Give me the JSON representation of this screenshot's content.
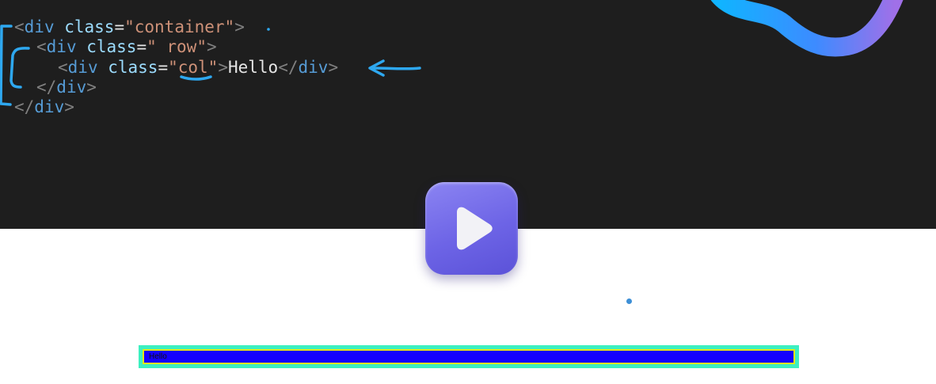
{
  "code": {
    "line1": {
      "open": "<",
      "tag": "div",
      "attr": " class",
      "eq": "=",
      "value": "\"container\"",
      "close": ">"
    },
    "line2": {
      "open": "<",
      "tag": "div",
      "attr": " class",
      "eq": "=",
      "value": "\" row\"",
      "close": ">"
    },
    "line3": {
      "open": "<",
      "tag": "div",
      "attr": " class",
      "eq": "=",
      "value": "\"col\"",
      "close": ">",
      "text": "Hello",
      "end_open": "</",
      "end_tag": "div",
      "end_close": ">"
    },
    "line4": {
      "open": "</",
      "tag": "div",
      "close": ">"
    },
    "line5": {
      "open": "</",
      "tag": "div",
      "close": ">"
    }
  },
  "preview": {
    "text": "Hello"
  },
  "colors": {
    "editor_bg": "#1e1e1e",
    "annotation": "#2ea8f0",
    "play_button": "#7068e8",
    "preview_fill": "#1400ff",
    "preview_border_outer": "#3df0c0",
    "preview_border_inner": "#e5e516"
  },
  "icons": {
    "play": "play-icon"
  }
}
